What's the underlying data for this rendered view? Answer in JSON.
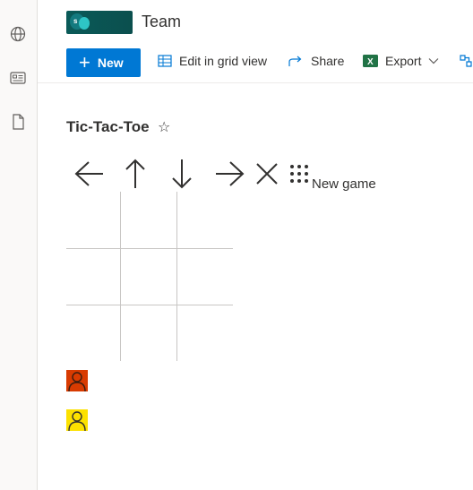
{
  "header": {
    "site_title": "Team",
    "logo_letter": "s"
  },
  "toolbar": {
    "new_label": "New",
    "edit_grid_label": "Edit in grid view",
    "share_label": "Share",
    "export_label": "Export"
  },
  "page": {
    "title": "Tic-Tac-Toe",
    "favorite_glyph": "☆"
  },
  "controls": {
    "left_glyph": "←",
    "up_glyph": "↑",
    "down_glyph": "↓",
    "right_glyph": "→",
    "close_glyph": "✕",
    "new_game_label": "New game"
  },
  "players": [
    {
      "icon": "person-icon",
      "color": "#d83b01"
    },
    {
      "icon": "person-icon",
      "color": "#fce100"
    }
  ],
  "colors": {
    "accent": "#0078d4",
    "logo_bg": "#0b4f4e",
    "excel_green": "#217346"
  }
}
